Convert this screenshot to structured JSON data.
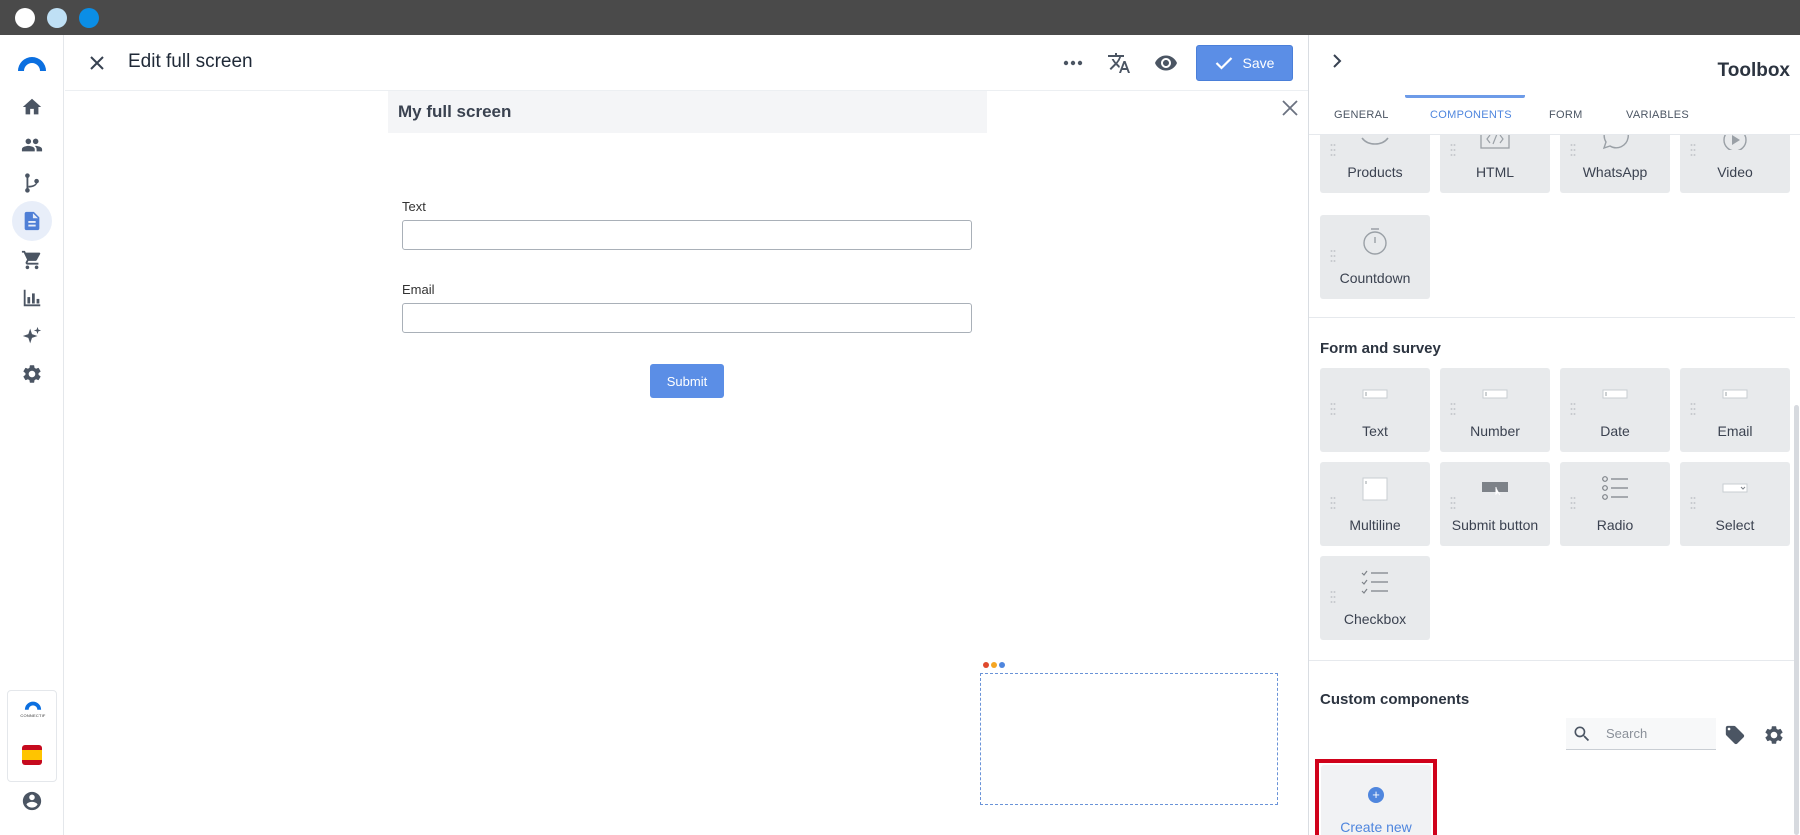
{
  "window": {
    "controls": [
      "close",
      "minimize",
      "maximize"
    ]
  },
  "nav": {
    "items": [
      {
        "name": "home",
        "icon": "home-icon"
      },
      {
        "name": "audience",
        "icon": "people-icon"
      },
      {
        "name": "flows",
        "icon": "branch-icon"
      },
      {
        "name": "content",
        "icon": "document-icon",
        "active": true
      },
      {
        "name": "commerce",
        "icon": "cart-icon"
      },
      {
        "name": "analytics",
        "icon": "bar-chart-icon"
      },
      {
        "name": "ai",
        "icon": "sparkles-icon"
      },
      {
        "name": "settings",
        "icon": "gear-icon"
      }
    ],
    "brand_label": "CONNECTIF",
    "language_flag": "spain-flag-icon",
    "account_icon": "user-circle-icon"
  },
  "header": {
    "title": "Edit full screen",
    "save_label": "Save",
    "icons": [
      "more-icon",
      "translate-icon",
      "eye-icon"
    ]
  },
  "canvas": {
    "screen_title": "My full screen",
    "fields": [
      {
        "label": "Text",
        "value": ""
      },
      {
        "label": "Email",
        "value": ""
      }
    ],
    "submit_label": "Submit"
  },
  "toolbox": {
    "title": "Toolbox",
    "tabs": [
      "GENERAL",
      "COMPONENTS",
      "FORM",
      "VARIABLES"
    ],
    "active_tab": "COMPONENTS",
    "components": [
      "Products",
      "HTML",
      "WhatsApp",
      "Video",
      "Countdown"
    ],
    "form_section_title": "Form and survey",
    "form_components": [
      "Text",
      "Number",
      "Date",
      "Email",
      "Multiline",
      "Submit button",
      "Radio",
      "Select",
      "Checkbox"
    ],
    "custom_section_title": "Custom components",
    "search_placeholder": "Search",
    "create_new_label": "Create new"
  },
  "colors": {
    "accent": "#5b8ee6",
    "highlight": "#d0021b",
    "titlebar": "#4a4a4a"
  }
}
